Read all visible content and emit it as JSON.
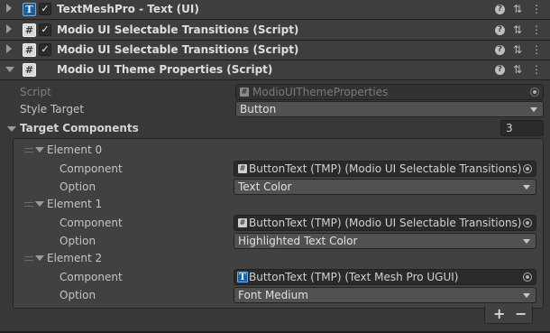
{
  "components": [
    {
      "title": "TextMeshPro - Text (UI)",
      "icon": "textmeshpro-icon",
      "checked": true,
      "expanded": false
    },
    {
      "title": "Modio UI Selectable Transitions (Script)",
      "icon": "script-icon",
      "checked": true,
      "expanded": false
    },
    {
      "title": "Modio UI Selectable Transitions (Script)",
      "icon": "script-icon",
      "checked": true,
      "expanded": false
    },
    {
      "title": "Modio UI Theme Properties (Script)",
      "icon": "script-icon",
      "checked": false,
      "expanded": true
    }
  ],
  "header_icons": {
    "help": "?",
    "presets": "⇅",
    "menu": "⋮"
  },
  "script": {
    "label": "Script",
    "value": "ModioUIThemeProperties"
  },
  "style_target": {
    "label": "Style Target",
    "value": "Button"
  },
  "target_components": {
    "label": "Target Components",
    "count": "3",
    "elements": [
      {
        "name": "Element 0",
        "component_label": "Component",
        "component": "ButtonText (TMP) (Modio UI Selectable Transitions)",
        "component_icon": "script-icon",
        "option_label": "Option",
        "option": "Text Color"
      },
      {
        "name": "Element 1",
        "component_label": "Component",
        "component": "ButtonText (TMP) (Modio UI Selectable Transitions)",
        "component_icon": "script-icon",
        "option_label": "Option",
        "option": "Highlighted Text Color"
      },
      {
        "name": "Element 2",
        "component_label": "Component",
        "component": "ButtonText (TMP) (Text Mesh Pro UGUI)",
        "component_icon": "textmeshpro-icon",
        "option_label": "Option",
        "option": "Font Medium"
      }
    ]
  },
  "footer": {
    "add": "+",
    "remove": "−"
  }
}
